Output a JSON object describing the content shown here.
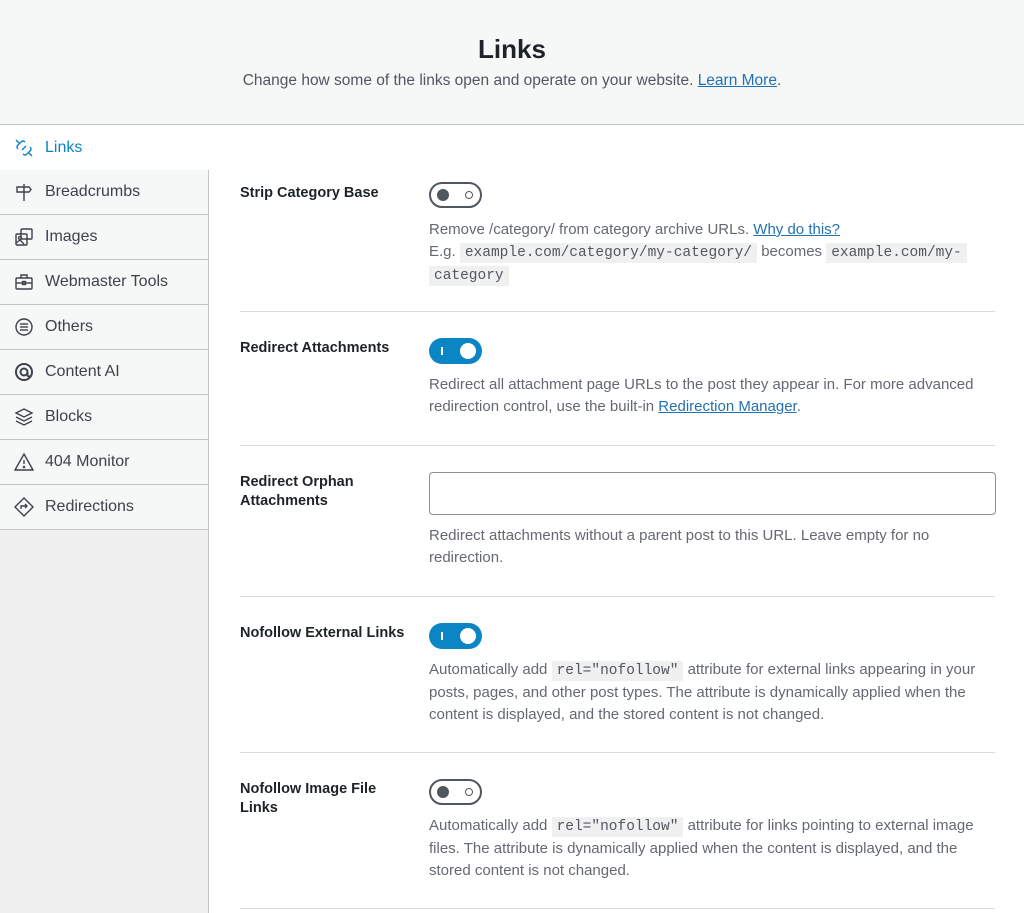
{
  "header": {
    "title": "Links",
    "subtitle": "Change how some of the links open and operate on your website.",
    "learn_more": "Learn More",
    "period": "."
  },
  "sidebar": {
    "items": [
      {
        "label": "Links",
        "icon": "links-icon"
      },
      {
        "label": "Breadcrumbs",
        "icon": "signpost-icon"
      },
      {
        "label": "Images",
        "icon": "images-icon"
      },
      {
        "label": "Webmaster Tools",
        "icon": "toolbox-icon"
      },
      {
        "label": "Others",
        "icon": "list-circle-icon"
      },
      {
        "label": "Content AI",
        "icon": "content-ai-icon"
      },
      {
        "label": "Blocks",
        "icon": "blocks-icon"
      },
      {
        "label": "404 Monitor",
        "icon": "warning-icon"
      },
      {
        "label": "Redirections",
        "icon": "redirect-icon"
      }
    ]
  },
  "settings": {
    "strip_category": {
      "label": "Strip Category Base",
      "enabled": false,
      "desc1": "Remove /category/ from category archive URLs.",
      "why_link": "Why do this?",
      "eg": "E.g.",
      "code1": "example.com/category/my-category/",
      "becomes": "becomes",
      "code2a": "example.com/my-",
      "code2b": "category"
    },
    "redirect_attachments": {
      "label": "Redirect Attachments",
      "enabled": true,
      "desc_a": "Redirect all attachment page URLs to the post they appear in. For more advanced",
      "desc_b": "redirection control, use the built-in",
      "link": "Redirection Manager",
      "period": "."
    },
    "redirect_orphan": {
      "label_a": "Redirect Orphan",
      "label_b": "Attachments",
      "value": "",
      "placeholder": "",
      "desc_a": "Redirect attachments without a parent post to this URL. Leave empty for no",
      "desc_b": "redirection."
    },
    "nofollow_external": {
      "label": "Nofollow External Links",
      "enabled": true,
      "desc_pre": "Automatically add",
      "code": "rel=\"nofollow\"",
      "desc_post": "attribute for external links appearing in your",
      "desc_b": "posts, pages, and other post types. The attribute is dynamically applied when the",
      "desc_c": "content is displayed, and the stored content is not changed."
    },
    "nofollow_image": {
      "label_a": "Nofollow Image File",
      "label_b": "Links",
      "enabled": false,
      "desc_pre": "Automatically add",
      "code": "rel=\"nofollow\"",
      "desc_post": "attribute for links pointing to external image",
      "desc_b": "files. The attribute is dynamically applied when the content is displayed, and the",
      "desc_c": "stored content is not changed."
    }
  },
  "colors": {
    "accent": "#0b85c4",
    "link": "#2271b1"
  }
}
